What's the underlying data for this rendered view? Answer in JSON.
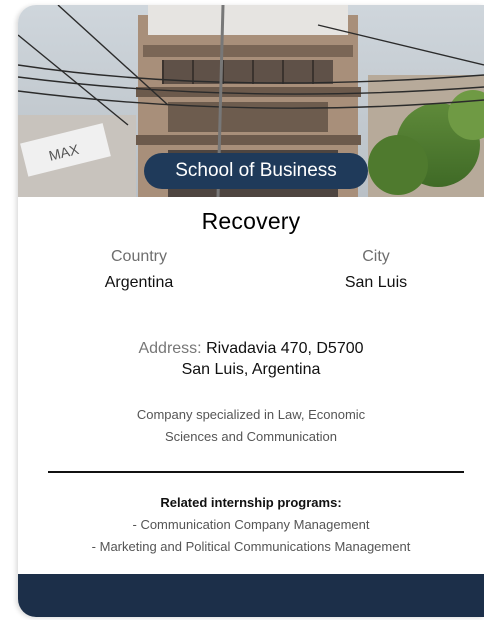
{
  "badge": "School of Business",
  "company_name": "Recovery",
  "country": {
    "label": "Country",
    "value": "Argentina"
  },
  "city": {
    "label": "City",
    "value": "San Luis"
  },
  "address": {
    "label": "Address:",
    "line1": "Rivadavia 470, D5700",
    "line2": "San Luis, Argentina"
  },
  "description": {
    "line1": "Company specialized in Law, Economic",
    "line2": "Sciences and Communication"
  },
  "related": {
    "title": "Related internship programs:",
    "items": [
      "- Communication Company Management",
      "- Marketing and Political Communications Management"
    ]
  },
  "colors": {
    "badge_bg": "#1f3a5a",
    "footer_bg": "#1c2f49"
  },
  "image": {
    "subject": "building-facade-photo",
    "sign_text": "MAX"
  }
}
